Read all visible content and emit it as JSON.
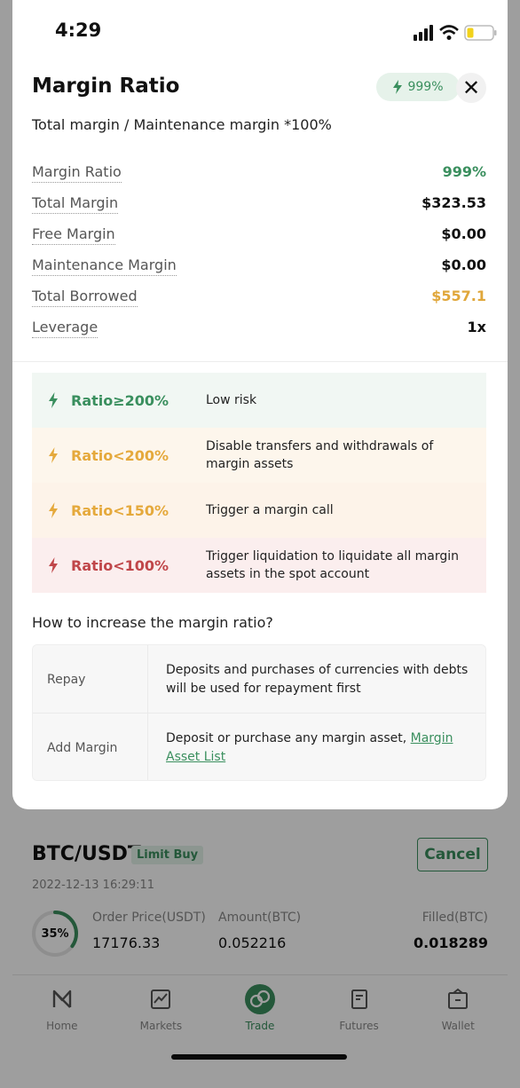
{
  "status_bar": {
    "time": "4:29"
  },
  "sheet": {
    "title": "Margin Ratio",
    "ratio_badge": "999%",
    "subtitle": "Total margin / Maintenance margin *100%",
    "metrics": [
      {
        "label": "Margin Ratio",
        "value": "999%",
        "tone": "green"
      },
      {
        "label": "Total Margin",
        "value": "$323.53",
        "tone": "default"
      },
      {
        "label": "Free Margin",
        "value": "$0.00",
        "tone": "default"
      },
      {
        "label": "Maintenance Margin",
        "value": "$0.00",
        "tone": "default"
      },
      {
        "label": "Total Borrowed",
        "value": "$557.1",
        "tone": "orange"
      },
      {
        "label": "Leverage",
        "value": "1x",
        "tone": "default"
      }
    ],
    "risk_levels": [
      {
        "label": "Ratio≥200%",
        "description": "Low risk",
        "color": "#3a8f5e",
        "bg": "#f1f7f3"
      },
      {
        "label": "Ratio<200%",
        "description": "Disable transfers and withdrawals of margin assets",
        "color": "#e5a93c",
        "bg": "#fdf6ec"
      },
      {
        "label": "Ratio<150%",
        "description": "Trigger a margin call",
        "color": "#e5a93c",
        "bg": "#fdf3e9"
      },
      {
        "label": "Ratio<100%",
        "description": "Trigger liquidation to liquidate all margin assets in the spot account",
        "color": "#c0474a",
        "bg": "#fbeeee"
      }
    ],
    "howto_title": "How to increase the margin ratio?",
    "guide": [
      {
        "key": "Repay",
        "text": "Deposits and purchases of currencies with debts will be used for repayment first",
        "link": ""
      },
      {
        "key": "Add Margin",
        "text": "Deposit or purchase any margin asset, ",
        "link": "Margin Asset List"
      }
    ]
  },
  "order": {
    "pair": "BTC/USDT",
    "side_badge": "Limit Buy",
    "cancel_label": "Cancel",
    "timestamp": "2022-12-13 16:29:11",
    "progress": "35%",
    "progress_fraction": 0.35,
    "price_label": "Order Price(USDT)",
    "price": "17176.33",
    "amount_label": "Amount(BTC)",
    "amount": "0.052216",
    "filled_label": "Filled(BTC)",
    "filled": "0.018289"
  },
  "tabbar": [
    {
      "label": "Home",
      "icon": "home-logo-icon",
      "active": false
    },
    {
      "label": "Markets",
      "icon": "chart-icon",
      "active": false
    },
    {
      "label": "Trade",
      "icon": "trade-icon",
      "active": true
    },
    {
      "label": "Futures",
      "icon": "futures-icon",
      "active": false
    },
    {
      "label": "Wallet",
      "icon": "wallet-icon",
      "active": false
    }
  ],
  "colors": {
    "accent": "#3a8f5e",
    "warning": "#e0a73b",
    "danger": "#c0474a"
  }
}
